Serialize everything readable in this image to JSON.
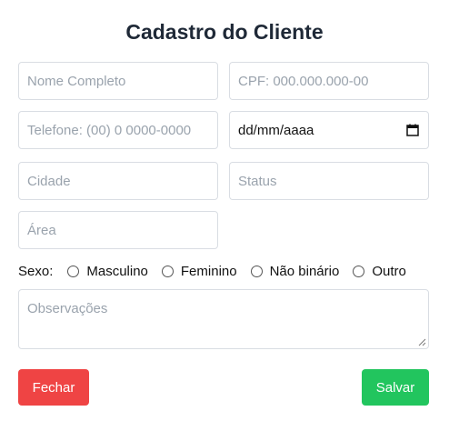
{
  "title": "Cadastro do Cliente",
  "fields": {
    "nome": {
      "placeholder": "Nome Completo"
    },
    "cpf": {
      "placeholder": "CPF: 000.000.000-00"
    },
    "telefone": {
      "placeholder": "Telefone: (00) 0 0000-0000"
    },
    "data": {
      "placeholder": "dd/mm/aaaa",
      "icon": "calendar-icon"
    },
    "cidade": {
      "placeholder": "Cidade"
    },
    "status": {
      "placeholder": "Status"
    },
    "area": {
      "placeholder": "Área"
    }
  },
  "sexo": {
    "label": "Sexo:",
    "options": [
      "Masculino",
      "Feminino",
      "Não binário",
      "Outro"
    ]
  },
  "observacoes": {
    "placeholder": "Observações"
  },
  "buttons": {
    "close": {
      "label": "Fechar",
      "color": "#ef4444"
    },
    "save": {
      "label": "Salvar",
      "color": "#22c55e"
    }
  }
}
